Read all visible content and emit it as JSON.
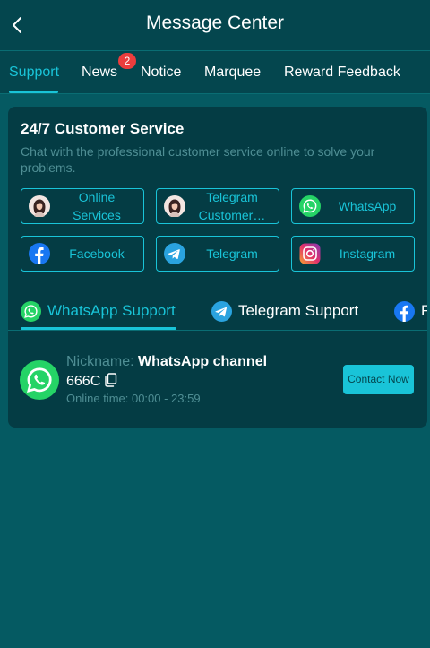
{
  "header": {
    "title": "Message Center"
  },
  "tabs": [
    {
      "label": "Support"
    },
    {
      "label": "News",
      "badge": "2"
    },
    {
      "label": "Notice"
    },
    {
      "label": "Marquee"
    },
    {
      "label": "Reward Feedback"
    }
  ],
  "service": {
    "title": "24/7 Customer Service",
    "subtitle": "Chat with the professional customer service online to solve your problems.",
    "buttons": [
      {
        "label": "Online Services",
        "icon": "agent-avatar-icon"
      },
      {
        "label": "Telegram Customer…",
        "icon": "agent-avatar-icon"
      },
      {
        "label": "WhatsApp",
        "icon": "whatsapp-icon"
      },
      {
        "label": "Facebook",
        "icon": "facebook-icon"
      },
      {
        "label": "Telegram",
        "icon": "telegram-icon"
      },
      {
        "label": "Instagram",
        "icon": "instagram-icon"
      }
    ]
  },
  "channel_tabs": [
    {
      "label": "WhatsApp Support",
      "icon": "whatsapp-icon"
    },
    {
      "label": "Telegram Support",
      "icon": "telegram-icon"
    },
    {
      "label": "F",
      "icon": "facebook-icon"
    }
  ],
  "contact": {
    "nickname_label": "Nickname:",
    "nickname_value": "WhatsApp channel",
    "number": "666C",
    "online_time": "Online time: 00:00 - 23:59",
    "button_label": "Contact Now"
  },
  "colors": {
    "accent": "#19c4d8",
    "background": "#055a62",
    "header": "#04464e",
    "card": "#043c44",
    "badge": "#ec3d3d",
    "whatsapp": "#25d366",
    "facebook": "#1877f2",
    "telegram": "#2aa3df"
  }
}
